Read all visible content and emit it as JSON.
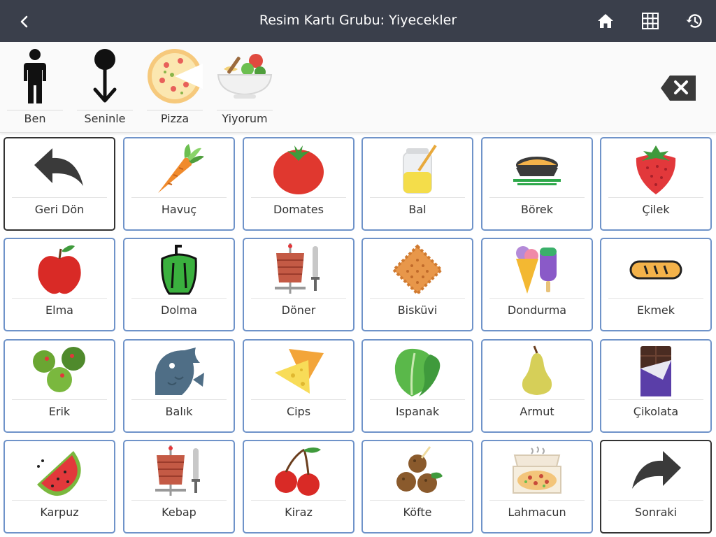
{
  "header": {
    "title": "Resim Kartı Grubu: Yiyecekler",
    "icons": [
      "chevron-left-icon",
      "home-icon",
      "grid-icon",
      "history-icon"
    ]
  },
  "sentence": {
    "words": [
      {
        "label": "Ben",
        "icon": "person-icon"
      },
      {
        "label": "Seninle",
        "icon": "person-arrow-down-icon"
      },
      {
        "label": "Pizza",
        "icon": "pizza-icon"
      },
      {
        "label": "Yiyorum",
        "icon": "eating-bowl-icon"
      }
    ],
    "delete_icon": "backspace-icon"
  },
  "cards": [
    {
      "label": "Geri Dön",
      "icon": "back-arrow-icon"
    },
    {
      "label": "Havuç",
      "icon": "carrot-icon"
    },
    {
      "label": "Domates",
      "icon": "tomato-icon"
    },
    {
      "label": "Bal",
      "icon": "honey-jar-icon"
    },
    {
      "label": "Börek",
      "icon": "pie-icon"
    },
    {
      "label": "Çilek",
      "icon": "strawberry-icon"
    },
    {
      "label": "Elma",
      "icon": "apple-icon"
    },
    {
      "label": "Dolma",
      "icon": "pepper-icon"
    },
    {
      "label": "Döner",
      "icon": "doner-icon"
    },
    {
      "label": "Bisküvi",
      "icon": "biscuit-icon"
    },
    {
      "label": "Dondurma",
      "icon": "ice-cream-icon"
    },
    {
      "label": "Ekmek",
      "icon": "bread-icon"
    },
    {
      "label": "Erik",
      "icon": "plum-icon"
    },
    {
      "label": "Balık",
      "icon": "fish-icon"
    },
    {
      "label": "Cips",
      "icon": "chips-icon"
    },
    {
      "label": "Ispanak",
      "icon": "spinach-icon"
    },
    {
      "label": "Armut",
      "icon": "pear-icon"
    },
    {
      "label": "Çikolata",
      "icon": "chocolate-icon"
    },
    {
      "label": "Karpuz",
      "icon": "watermelon-icon"
    },
    {
      "label": "Kebap",
      "icon": "kebab-icon"
    },
    {
      "label": "Kiraz",
      "icon": "cherry-icon"
    },
    {
      "label": "Köfte",
      "icon": "meatball-icon"
    },
    {
      "label": "Lahmacun",
      "icon": "lahmacun-icon"
    },
    {
      "label": "Sonraki",
      "icon": "forward-arrow-icon"
    }
  ],
  "colors": {
    "header_bg": "#3a3f4b",
    "card_border": "#6f93c9",
    "nav_card_border": "#333333"
  }
}
